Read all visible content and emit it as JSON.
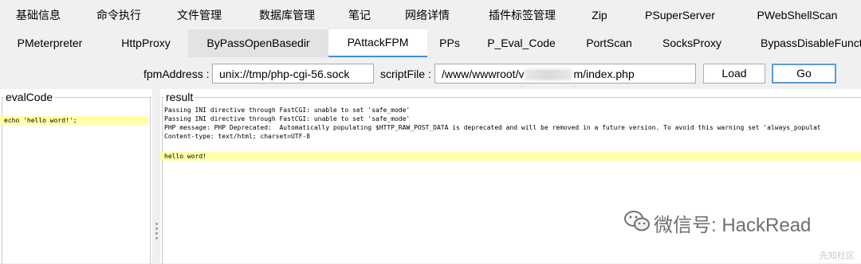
{
  "tabs_row1": [
    "基础信息",
    "命令执行",
    "文件管理",
    "数据库管理",
    "笔记",
    "网络详情",
    "插件标签管理",
    "Zip",
    "PSuperServer",
    "PWebShellScan"
  ],
  "tabs_row2": [
    "PMeterpreter",
    "HttpProxy",
    "ByPassOpenBasedir",
    "PAttackFPM",
    "PPs",
    "P_Eval_Code",
    "PortScan",
    "SocksProxy",
    "BypassDisableFunct"
  ],
  "active_tab": "PAttackFPM",
  "toolbar": {
    "fpm_label": "fpmAddress :",
    "fpm_value": "unix://tmp/php-cgi-56.sock",
    "script_label": "scriptFile :",
    "script_prefix": "/www/wwwroot/v",
    "script_suffix": "m/index.php",
    "load_label": "Load",
    "go_label": "Go"
  },
  "eval_panel": {
    "title": "evalCode",
    "code": "echo 'hello word!';"
  },
  "result_panel": {
    "title": "result",
    "lines": [
      "Passing INI directive through FastCGI: unable to set 'safe_mode'",
      "Passing INI directive through FastCGI: unable to set 'safe_mode'",
      "PHP message: PHP Deprecated:  Automatically populating $HTTP_RAW_POST_DATA is deprecated and will be removed in a future version. To avoid this warning set 'always_populat",
      "Content-type: text/html; charset=UTF-8"
    ],
    "output": "hello word!"
  },
  "watermark": {
    "text": "微信号: HackRead",
    "icon": "wechat-icon",
    "corner": "先知社区"
  },
  "colors": {
    "highlight": "#ffff99",
    "active_underline": "#3d8ee6",
    "focus_border": "#5b9bd5"
  }
}
